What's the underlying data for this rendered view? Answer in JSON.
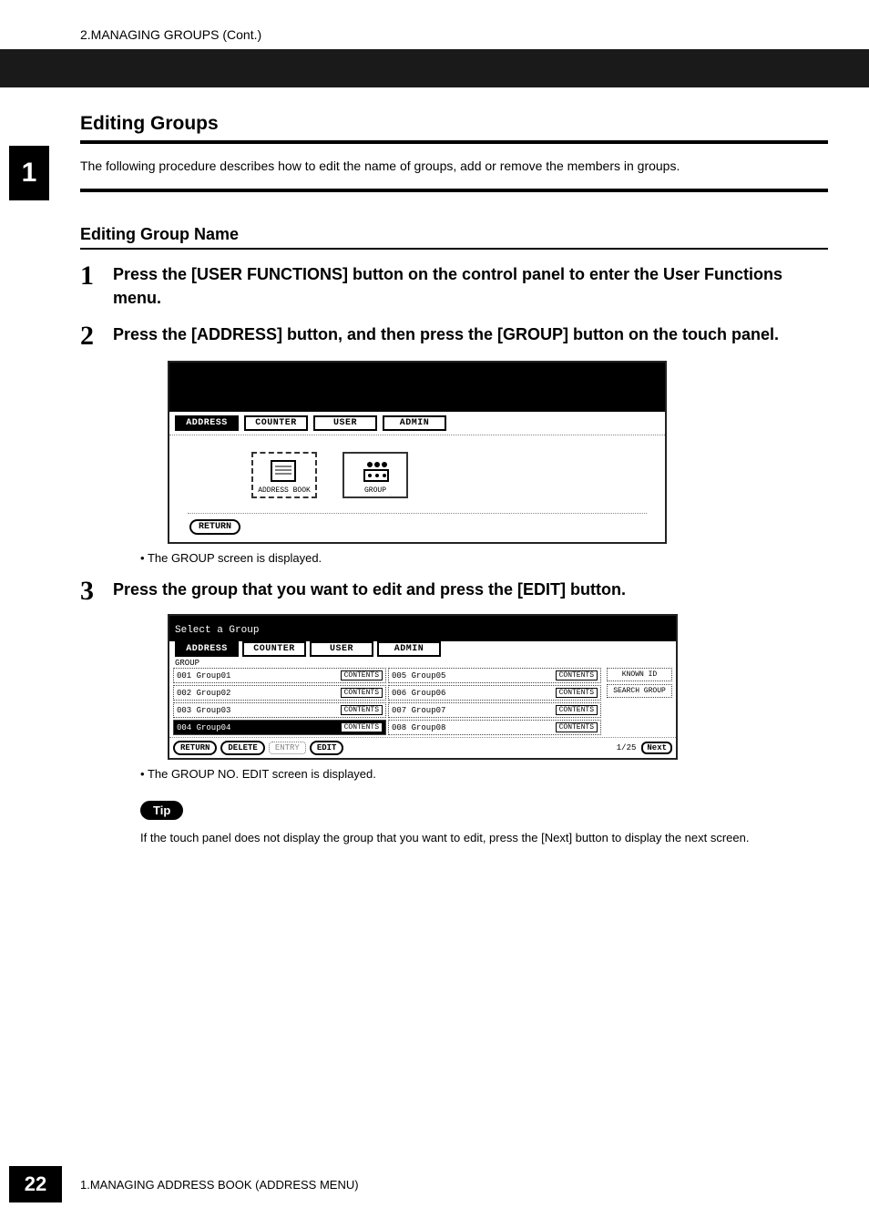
{
  "header": {
    "running_head": "2.MANAGING GROUPS (Cont.)"
  },
  "chapter_tab": "1",
  "section": {
    "title": "Editing Groups",
    "intro": "The following procedure describes how to edit the name of groups, add or remove the members in groups."
  },
  "subsection": {
    "title": "Editing Group Name"
  },
  "steps": [
    {
      "num": "1",
      "text": "Press the [USER FUNCTIONS] button on the control panel to enter the User Functions menu."
    },
    {
      "num": "2",
      "text": "Press the [ADDRESS] button, and then press the [GROUP] button on the touch panel.",
      "note_after_image": "The GROUP screen is displayed."
    },
    {
      "num": "3",
      "text": "Press the group that you want to edit and press the [EDIT] button.",
      "note_after_image": "The GROUP NO. EDIT screen is displayed."
    }
  ],
  "lcd1": {
    "tabs": [
      "ADDRESS",
      "COUNTER",
      "USER",
      "ADMIN"
    ],
    "active_tab": "ADDRESS",
    "icons": [
      {
        "label": "ADDRESS BOOK"
      },
      {
        "label": "GROUP"
      }
    ],
    "return_btn": "RETURN"
  },
  "lcd2": {
    "prompt": "Select a Group",
    "tabs": [
      "ADDRESS",
      "COUNTER",
      "USER",
      "ADMIN"
    ],
    "active_tab": "ADDRESS",
    "section_label": "GROUP",
    "left_col": [
      {
        "id": "001",
        "name": "Group01",
        "btn": "CONTENTS"
      },
      {
        "id": "002",
        "name": "Group02",
        "btn": "CONTENTS"
      },
      {
        "id": "003",
        "name": "Group03",
        "btn": "CONTENTS"
      },
      {
        "id": "004",
        "name": "Group04",
        "btn": "CONTENTS",
        "selected": true
      }
    ],
    "right_col": [
      {
        "id": "005",
        "name": "Group05",
        "btn": "CONTENTS"
      },
      {
        "id": "006",
        "name": "Group06",
        "btn": "CONTENTS"
      },
      {
        "id": "007",
        "name": "Group07",
        "btn": "CONTENTS"
      },
      {
        "id": "008",
        "name": "Group08",
        "btn": "CONTENTS"
      }
    ],
    "side_buttons": [
      "KNOWN ID",
      "SEARCH GROUP"
    ],
    "bottom_buttons": {
      "return": "RETURN",
      "delete": "DELETE",
      "entry": "ENTRY",
      "edit": "EDIT"
    },
    "pager": {
      "current": "1",
      "total": "25",
      "next": "Next"
    }
  },
  "tip": {
    "label": "Tip",
    "text": "If the touch panel does not display the group that you want to edit, press the [Next] button to display the next screen."
  },
  "footer": {
    "page_num": "22",
    "text": "1.MANAGING ADDRESS BOOK (ADDRESS MENU)"
  }
}
